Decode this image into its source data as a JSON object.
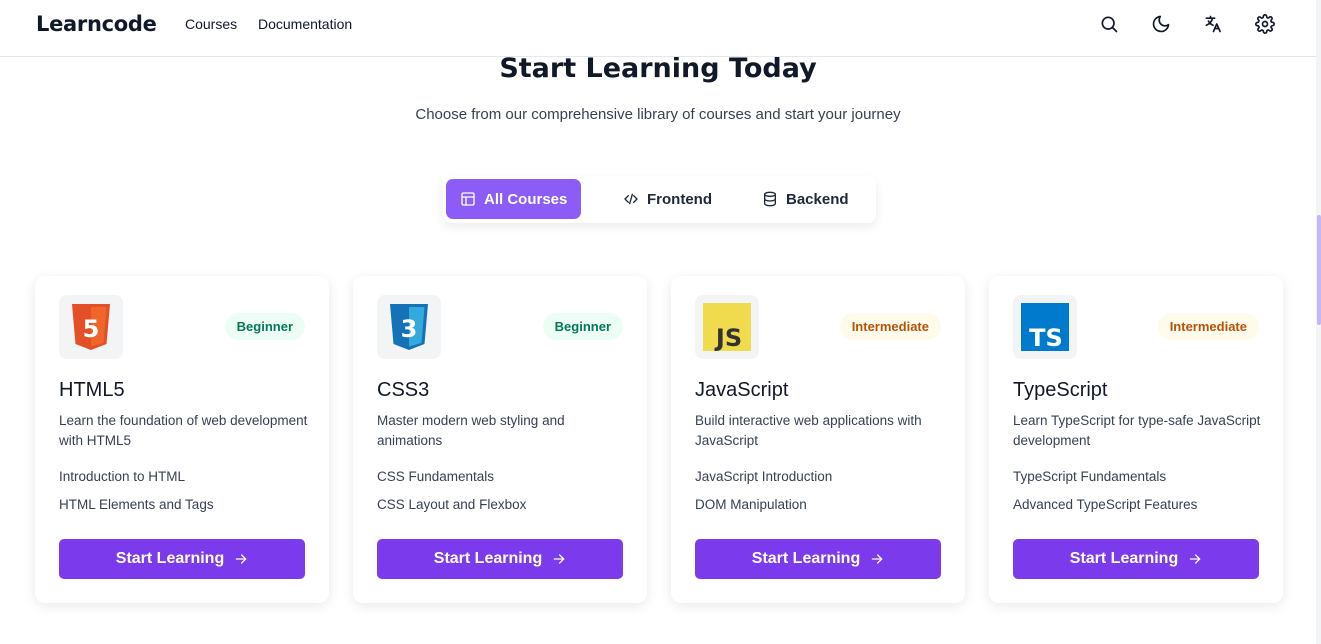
{
  "header": {
    "logo": "Learncode",
    "nav": [
      "Courses",
      "Documentation"
    ],
    "icons": [
      "search-icon",
      "moon-icon",
      "translate-icon",
      "gear-icon"
    ]
  },
  "hero": {
    "title": "Start Learning Today",
    "subtitle": "Choose from our comprehensive library of courses and start your journey"
  },
  "filters": {
    "tabs": [
      {
        "label": "All Courses",
        "icon": "layout-icon",
        "active": true
      },
      {
        "label": "Frontend",
        "icon": "code-icon",
        "active": false
      },
      {
        "label": "Backend",
        "icon": "database-icon",
        "active": false
      }
    ],
    "active_color": "#8b5cf6"
  },
  "courses": [
    {
      "title": "HTML5",
      "level": "Beginner",
      "description": "Learn the foundation of web development with HTML5",
      "topics": [
        "Introduction to HTML",
        "HTML Elements and Tags"
      ],
      "button": "Start Learning",
      "logo": "html5-logo",
      "logo_text": "5"
    },
    {
      "title": "CSS3",
      "level": "Beginner",
      "description": "Master modern web styling and animations",
      "topics": [
        "CSS Fundamentals",
        "CSS Layout and Flexbox"
      ],
      "button": "Start Learning",
      "logo": "css3-logo",
      "logo_text": "3"
    },
    {
      "title": "JavaScript",
      "level": "Intermediate",
      "description": "Build interactive web applications with JavaScript",
      "topics": [
        "JavaScript Introduction",
        "DOM Manipulation"
      ],
      "button": "Start Learning",
      "logo": "js-logo",
      "logo_text": "JS"
    },
    {
      "title": "TypeScript",
      "level": "Intermediate",
      "description": "Learn TypeScript for type-safe JavaScript development",
      "topics": [
        "TypeScript Fundamentals",
        "Advanced TypeScript Features"
      ],
      "button": "Start Learning",
      "logo": "ts-logo",
      "logo_text": "TS"
    }
  ],
  "colors": {
    "primary_button": "#7c3aed",
    "beginner_badge": "#047857",
    "intermediate_badge": "#b45309"
  }
}
